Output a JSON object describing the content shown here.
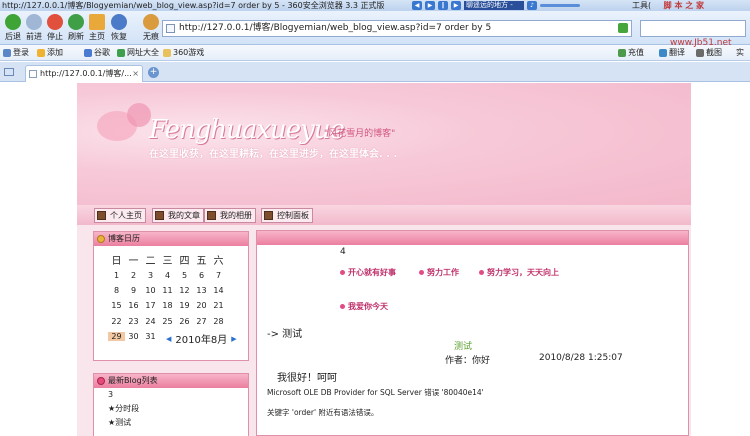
{
  "window": {
    "title": "http://127.0.0.1/博客/Blogyemian/web_blog_view.asp?id=7 order by 5 - 360安全浏览器 3.3 正式版",
    "song": "聊遥远的地方 -",
    "tools_menu": "工具(",
    "watermark_top": "脚 本 之 家",
    "watermark_url": "www.Jb51.net"
  },
  "nav": {
    "back": "后退",
    "forward": "前进",
    "stop": "停止",
    "refresh": "刷新",
    "home": "主页",
    "restore": "恢复",
    "none": "无痕"
  },
  "address": {
    "url": "http://127.0.0.1/博客/Blogyemian/web_blog_view.asp?id=7 order by 5"
  },
  "favbar": {
    "login": "登录",
    "add": "添加",
    "google": "谷歌",
    "nav_site": "网址大全",
    "games": "360游戏",
    "recharge": "充值",
    "translate": "翻译",
    "screenshot": "截图",
    "more": "实"
  },
  "tab": {
    "label": "http://127.0.0.1/博客/..."
  },
  "banner": {
    "brand": "Fenghuaxueyue",
    "brand_cn": "\"风花雪月的博客\"",
    "slogan": "在这里收获，在这里耕耘，在这里进步，在这里体会. . ."
  },
  "menu": [
    "个人主页",
    "我的文章",
    "我的相册",
    "控制面板"
  ],
  "calendar": {
    "header": "博客日历",
    "weekdays": [
      "日",
      "一",
      "二",
      "三",
      "四",
      "五",
      "六"
    ],
    "weeks": [
      [
        "1",
        "2",
        "3",
        "4",
        "5",
        "6",
        "7"
      ],
      [
        "8",
        "9",
        "10",
        "11",
        "12",
        "13",
        "14"
      ],
      [
        "15",
        "16",
        "17",
        "18",
        "19",
        "20",
        "21"
      ],
      [
        "22",
        "23",
        "24",
        "25",
        "26",
        "27",
        "28"
      ],
      [
        "29",
        "30",
        "31"
      ]
    ],
    "month": "2010年8月",
    "prev": "◀",
    "next": "▶"
  },
  "bloglist": {
    "header": "最新Blog列表",
    "count": "3",
    "items": [
      "★分时段",
      "★测试"
    ]
  },
  "main": {
    "num": "4",
    "categories": [
      "开心就有好事",
      "努力工作",
      "努力学习，天天向上",
      "我爱你今天"
    ],
    "article_title": "-> 测试",
    "green_title": "测试",
    "author": "作者：你好",
    "date": "2010/8/28 1:25:07",
    "body": "我很好！呵呵",
    "error1": "Microsoft OLE DB Provider for SQL Server  错误 '80040e14'",
    "error2": "关键字 'order' 附近有语法错误。"
  }
}
